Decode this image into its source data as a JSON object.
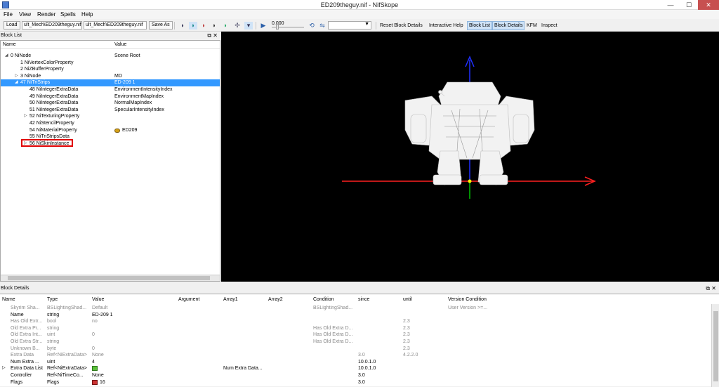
{
  "window": {
    "title": "ED209theguy.nif - NifSkope",
    "minimize": "—",
    "maximize": "☐",
    "close": "✕"
  },
  "menu": {
    "file": "File",
    "view": "View",
    "render": "Render",
    "spells": "Spells",
    "help": "Help"
  },
  "toolbar": {
    "load": "Load",
    "load_path": "ult_Mech\\ED209theguy.nif",
    "save_path": "ult_Mech\\ED209theguy.nif",
    "save_as": "Save As",
    "frame_time": "0.000",
    "reset_block_details": "Reset Block Details",
    "interactive_help": "Interactive Help",
    "block_list": "Block List",
    "block_details": "Block Details",
    "kfm": "KFM",
    "inspect": "Inspect"
  },
  "block_list": {
    "title": "Block List",
    "col_name": "Name",
    "col_value": "Value",
    "rows": [
      {
        "label": "0 NiNode",
        "value": "Scene Root",
        "exp": "◢",
        "indent": 0
      },
      {
        "label": "1 NiVertexColorProperty",
        "value": "",
        "exp": "",
        "indent": 1
      },
      {
        "label": "2 NiZBufferProperty",
        "value": "",
        "exp": "",
        "indent": 1
      },
      {
        "label": "3 NiNode",
        "value": "MD",
        "exp": "▷",
        "indent": 1
      },
      {
        "label": "47 NiTriStrips",
        "value": "ED-209 1",
        "exp": "◢",
        "indent": 1,
        "selected": true
      },
      {
        "label": "48 NiIntegerExtraData",
        "value": "EnvironmentIntensityIndex",
        "exp": "",
        "indent": 2
      },
      {
        "label": "49 NiIntegerExtraData",
        "value": "EnvironmentMapIndex",
        "exp": "",
        "indent": 2
      },
      {
        "label": "50 NiIntegerExtraData",
        "value": "NormalMapIndex",
        "exp": "",
        "indent": 2
      },
      {
        "label": "51 NiIntegerExtraData",
        "value": "SpecularIntensityIndex",
        "exp": "",
        "indent": 2
      },
      {
        "label": "52 NiTexturingProperty",
        "value": "",
        "exp": "▷",
        "indent": 2
      },
      {
        "label": "42 NiStencilProperty",
        "value": "",
        "exp": "",
        "indent": 2
      },
      {
        "label": "54 NiMaterialProperty",
        "value": "ED209",
        "exp": "",
        "indent": 2,
        "icon": true
      },
      {
        "label": "55 NiTriStripsData",
        "value": "",
        "exp": "",
        "indent": 2
      },
      {
        "label": "56 NiSkinInstance",
        "value": "",
        "exp": "▷",
        "indent": 2
      }
    ]
  },
  "block_details": {
    "title": "Block Details",
    "columns": [
      "Name",
      "Type",
      "Value",
      "Argument",
      "Array1",
      "Array2",
      "Condition",
      "since",
      "until",
      "Version Condition"
    ],
    "rows": [
      {
        "name": "Skyrim Sha...",
        "type": "BSLightingShad...",
        "value": "Default",
        "arg": "",
        "a1": "",
        "cond": "BSLightingShad...",
        "since": "",
        "until": "",
        "vcond": "User Version >=...",
        "gray": true
      },
      {
        "name": "Name",
        "type": "string",
        "value": "ED-209 1",
        "arg": "",
        "a1": "",
        "cond": "",
        "since": "",
        "until": "",
        "vcond": "",
        "gray": false
      },
      {
        "name": "Has Old Extr...",
        "type": "bool",
        "value": "no",
        "arg": "",
        "a1": "",
        "cond": "",
        "since": "",
        "until": "2.3",
        "vcond": "",
        "gray": true
      },
      {
        "name": "Old Extra Pr...",
        "type": "string",
        "value": "",
        "arg": "",
        "a1": "",
        "cond": "Has Old Extra D...",
        "since": "",
        "until": "2.3",
        "vcond": "",
        "gray": true
      },
      {
        "name": "Old Extra Int...",
        "type": "uint",
        "value": "0",
        "arg": "",
        "a1": "",
        "cond": "Has Old Extra D...",
        "since": "",
        "until": "2.3",
        "vcond": "",
        "gray": true
      },
      {
        "name": "Old Extra Str...",
        "type": "string",
        "value": "",
        "arg": "",
        "a1": "",
        "cond": "Has Old Extra D...",
        "since": "",
        "until": "2.3",
        "vcond": "",
        "gray": true
      },
      {
        "name": "Unknown B...",
        "type": "byte",
        "value": "0",
        "arg": "",
        "a1": "",
        "cond": "",
        "since": "",
        "until": "2.3",
        "vcond": "",
        "gray": true
      },
      {
        "name": "Extra Data",
        "type": "Ref<NiExtraData>",
        "value": "None",
        "arg": "",
        "a1": "",
        "cond": "",
        "since": "3.0",
        "until": "4.2.2.0",
        "vcond": "",
        "gray": true
      },
      {
        "name": "Num Extra ...",
        "type": "uint",
        "value": "4",
        "arg": "",
        "a1": "",
        "cond": "",
        "since": "10.0.1.0",
        "until": "",
        "vcond": "",
        "gray": false
      },
      {
        "name": "Extra Data List",
        "type": "Ref<NiExtraData>",
        "value": "",
        "arg": "",
        "a1": "Num Extra Data...",
        "cond": "",
        "since": "10.0.1.0",
        "until": "",
        "vcond": "",
        "gray": false,
        "exp": "▷",
        "icon": "green"
      },
      {
        "name": "Controller",
        "type": "Ref<NiTimeCo...",
        "value": "None",
        "arg": "",
        "a1": "",
        "cond": "",
        "since": "3.0",
        "until": "",
        "vcond": "",
        "gray": false
      },
      {
        "name": "Flags",
        "type": "Flags",
        "value": "16",
        "arg": "",
        "a1": "",
        "cond": "",
        "since": "3.0",
        "until": "",
        "vcond": "",
        "gray": false,
        "icon": "flag"
      }
    ]
  },
  "viewport": {
    "axis_colors": {
      "x": "#ff2020",
      "y": "#00c000",
      "z": "#2030ff"
    }
  }
}
